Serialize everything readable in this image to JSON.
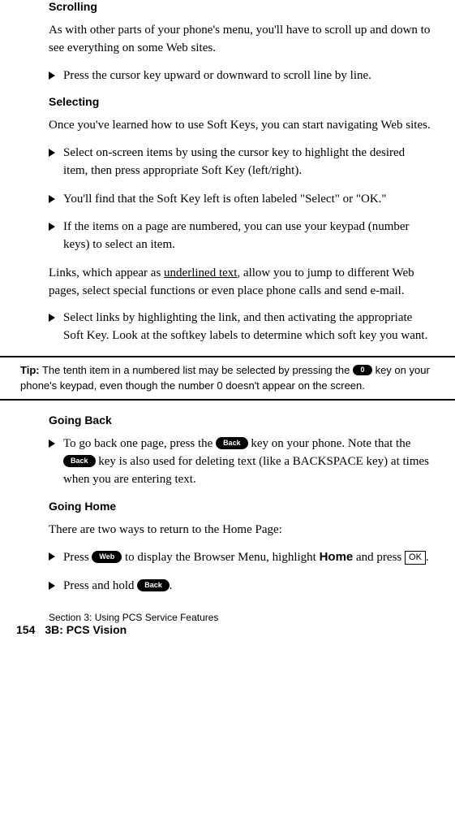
{
  "h_scrolling": "Scrolling",
  "p_scrolling": "As with other parts of your phone's menu, you'll have to scroll up and down to see everything on some Web sites.",
  "b_scroll1": "Press the cursor key upward or downward to scroll line by line.",
  "h_selecting": "Selecting",
  "p_selecting": "Once you've learned how to use Soft Keys, you can start navigating Web sites.",
  "b_sel1": "Select on-screen items by using the cursor key to highlight the desired item, then press appropriate Soft Key (left/right).",
  "b_sel2": "You'll find that the Soft Key left is often labeled \"Select\" or \"OK.\"",
  "b_sel3": "If the items on a page are numbered, you can use your keypad (number keys) to select an item.",
  "p_links_pre": "Links, which appear as ",
  "p_links_underlined": "underlined text",
  "p_links_post": ", allow you to jump to different Web pages, select special functions or even place phone calls and send e-mail.",
  "b_sel4": "Select links by highlighting the link, and then activating the appropriate Soft Key. Look at the softkey labels to determine which soft key you want.",
  "tip_label": "Tip:",
  "tip_pre": " The tenth item in a numbered list may be selected by pressing the ",
  "tip_key": "0",
  "tip_post": " key on your phone's keypad, even though the number 0 doesn't appear on the screen.",
  "h_goingback": "Going Back",
  "gb_pre": "To go back one page, press the ",
  "gb_key1": "Back",
  "gb_mid": " key on your phone. Note that the ",
  "gb_key2": "Back",
  "gb_post": " key is also used for deleting text (like a BACKSPACE key) at times when you are entering text.",
  "h_goinghome": "Going Home",
  "p_goinghome": "There are two ways to return to the Home Page:",
  "gh1_pre": "Press ",
  "gh1_key": "Web",
  "gh1_mid": " to display the Browser Menu, highlight ",
  "gh1_bold": "Home",
  "gh1_post1": " and press ",
  "gh1_ok": "OK",
  "gh1_post2": ".",
  "gh2_pre": "Press and hold ",
  "gh2_key": "Back",
  "gh2_post": ".",
  "footer_l1": "Section 3: Using PCS Service Features",
  "page_num": "154",
  "footer_l2": "3B: PCS Vision"
}
